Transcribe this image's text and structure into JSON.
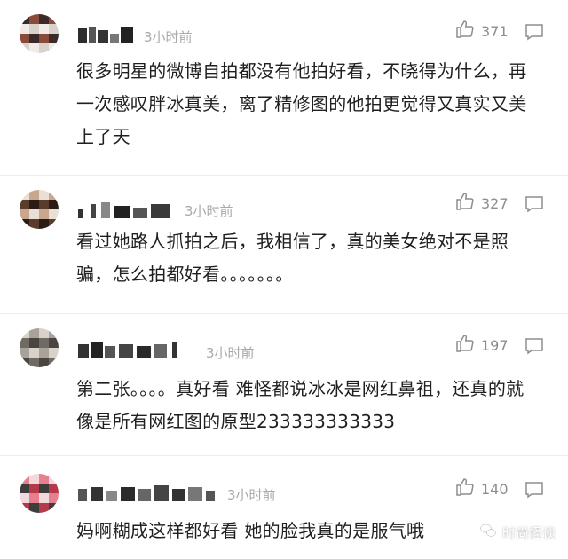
{
  "comments": [
    {
      "time": "3小时前",
      "likes": "371",
      "text": "很多明星的微博自拍都没有他拍好看，不晓得为什么，再一次感叹胖冰真美，离了精修图的他拍更觉得又真实又美上了天",
      "avatar_colors": [
        "#3a2a2a",
        "#d9d2cb",
        "#8a4b3a",
        "#f0ebe6"
      ]
    },
    {
      "time": "3小时前",
      "likes": "327",
      "text": "看过她路人抓拍之后，我相信了，真的美女绝对不是照骗，怎么拍都好看。。。。。。。",
      "avatar_colors": [
        "#5b3b2a",
        "#e8e0d6",
        "#2b1d16",
        "#c9a78f"
      ]
    },
    {
      "time": "3小时前",
      "likes": "197",
      "text": "第二张。。。。真好看 难怪都说冰冰是网红鼻祖，还真的就像是所有网红图的原型233333333333",
      "avatar_colors": [
        "#a8a29a",
        "#6e6a64",
        "#d8d2c9",
        "#4a4540"
      ]
    },
    {
      "time": "3小时前",
      "likes": "140",
      "text": "妈啊糊成这样都好看 她的脸我真的是服气哦",
      "avatar_colors": [
        "#b33a4a",
        "#f0d8dc",
        "#3d3d3d",
        "#e77f8c"
      ]
    }
  ],
  "watermark": {
    "label": "时尚怪谈"
  }
}
